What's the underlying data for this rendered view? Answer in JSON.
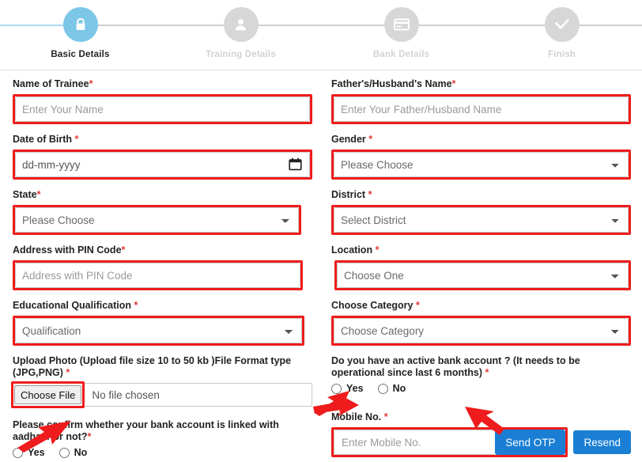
{
  "stepper": {
    "steps": [
      {
        "label": "Basic Details",
        "icon": "lock-icon",
        "state": "active"
      },
      {
        "label": "Training Details",
        "icon": "user-icon",
        "state": "inactive"
      },
      {
        "label": "Bank Details",
        "icon": "card-icon",
        "state": "inactive"
      },
      {
        "label": "Finish",
        "icon": "check-icon",
        "state": "inactive"
      }
    ],
    "active_color": "#7cc6e8",
    "inactive_color": "#d7d7d7"
  },
  "form": {
    "name": {
      "label": "Name of Trainee",
      "required": "*",
      "placeholder": "Enter Your Name",
      "value": ""
    },
    "father": {
      "label": "Father's/Husband's Name",
      "required": "*",
      "placeholder": "Enter Your Father/Husband Name",
      "value": ""
    },
    "dob": {
      "label": "Date of Birth",
      "required": "*",
      "placeholder": "dd-mm-yyyy",
      "value": "dd-mm-yyyy"
    },
    "gender": {
      "label": "Gender",
      "required": "*",
      "selected": "Please Choose"
    },
    "state": {
      "label": "State",
      "required": "*",
      "selected": "Please Choose"
    },
    "district": {
      "label": "District",
      "required": "*",
      "selected": "Select District"
    },
    "address": {
      "label": "Address with PIN Code",
      "required": "*",
      "placeholder": "Address with PIN Code",
      "value": ""
    },
    "location": {
      "label": "Location",
      "required": "*",
      "selected": "Choose One"
    },
    "qualification": {
      "label": "Educational Qualification",
      "required": "*",
      "selected": "Qualification"
    },
    "category": {
      "label": "Choose Category",
      "required": "*",
      "selected": "Choose Category"
    },
    "upload": {
      "label": "Upload Photo (Upload file size 10 to 50 kb )File Format type (JPG,PNG)",
      "required": "*",
      "button_label": "Choose File",
      "file_status": "No file chosen"
    },
    "aadhaar_linked": {
      "label": "Please confirm whether your bank account is linked with aadhaar or not?",
      "required": "*",
      "options": [
        {
          "label": "Yes",
          "checked": false
        },
        {
          "label": "No",
          "checked": false
        }
      ]
    },
    "bank_account": {
      "label": "Do you have an active bank account ? (It needs to be operational since last 6 months)",
      "required": "*",
      "options": [
        {
          "label": "Yes",
          "checked": false
        },
        {
          "label": "No",
          "checked": false
        }
      ]
    },
    "mobile": {
      "label": "Mobile No.",
      "required": "*",
      "placeholder": "Enter Mobile No.",
      "value": "",
      "send_otp_label": "Send OTP",
      "resend_label": "Resend",
      "button_color": "#1a7fd4"
    }
  },
  "annotations": {
    "highlight_color": "#ee1c1c",
    "arrows": [
      {
        "name": "arrow-to-choose-file-row",
        "direction": "left"
      },
      {
        "name": "arrow-to-aadhaar-yes-radio",
        "direction": "down-left"
      },
      {
        "name": "arrow-to-send-otp-button",
        "direction": "down-right"
      },
      {
        "name": "arrow-to-bank-account-yes-radio",
        "direction": "up-right"
      }
    ]
  }
}
